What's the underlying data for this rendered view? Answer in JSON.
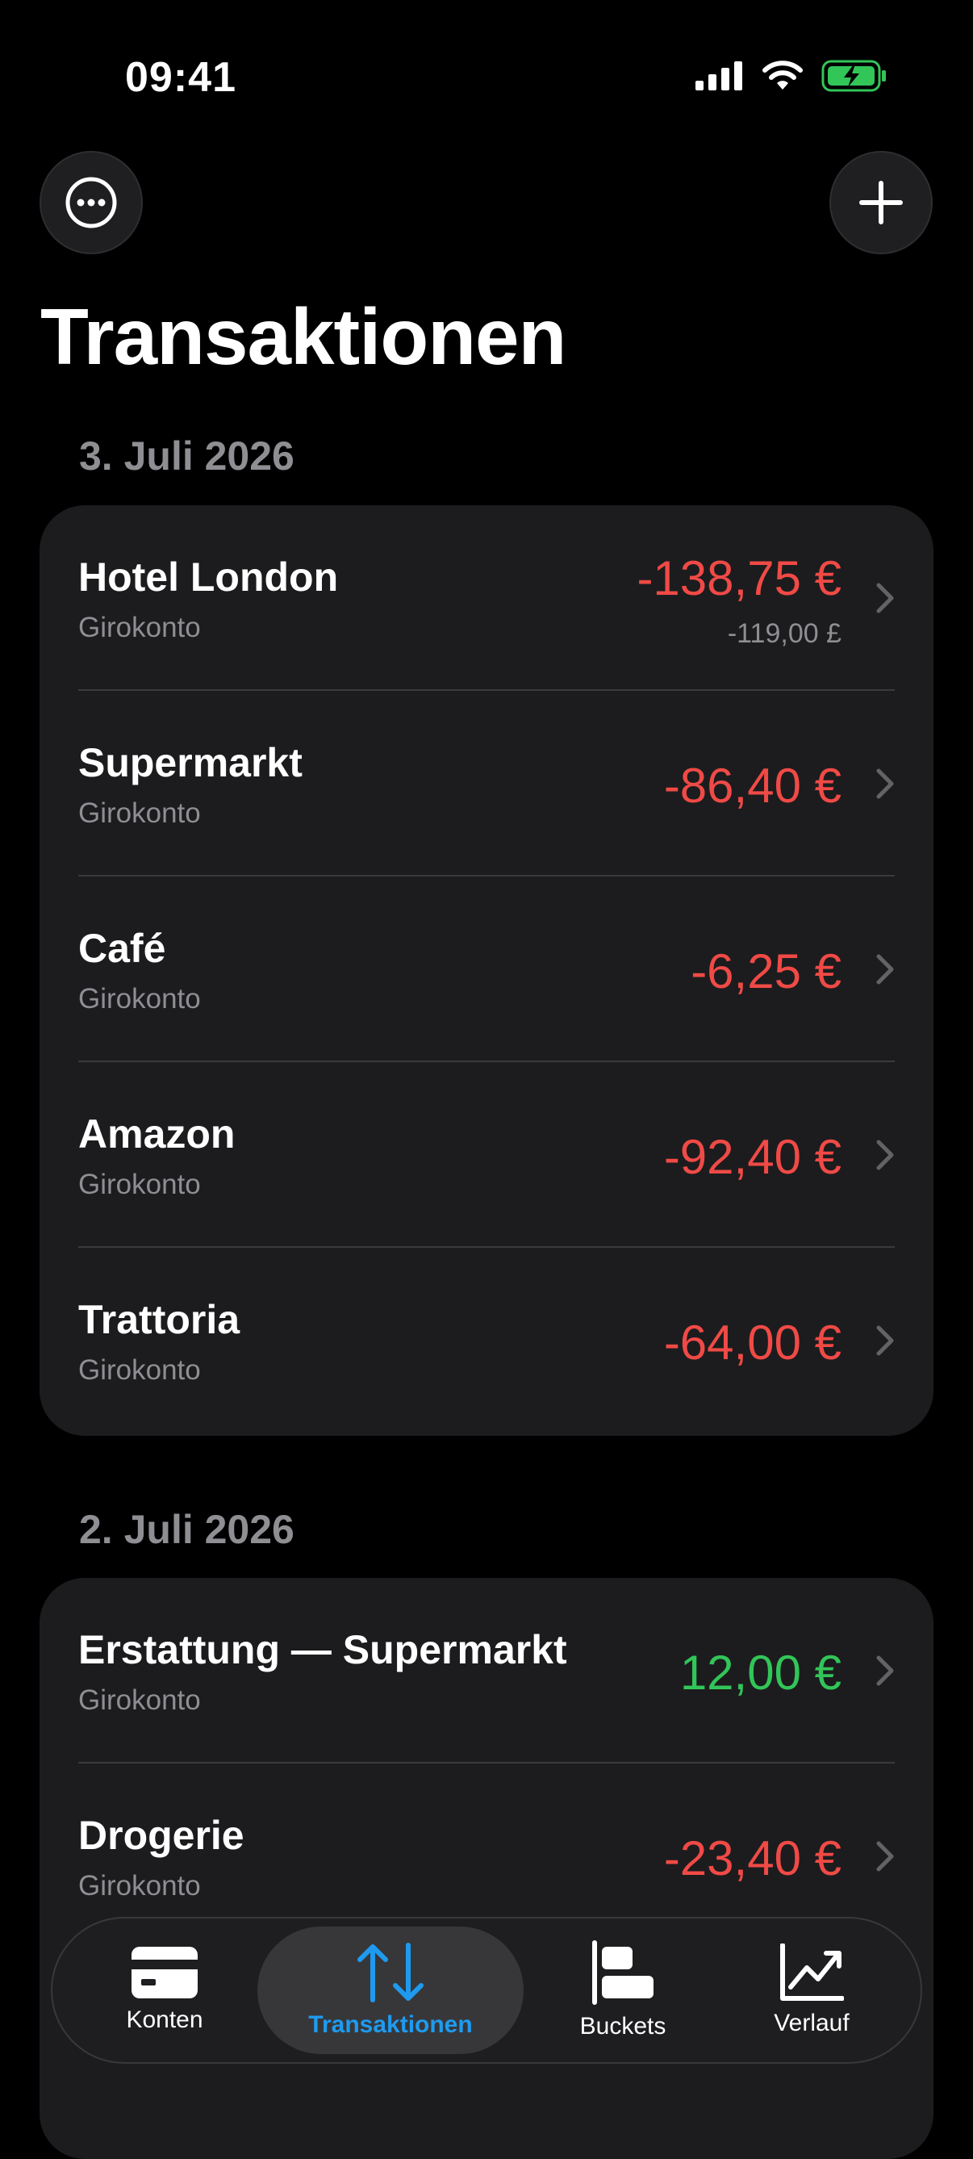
{
  "status_bar": {
    "time": "09:41",
    "icons": [
      "signal-icon",
      "wifi-icon",
      "battery-charging-icon"
    ]
  },
  "toolbar": {
    "more_icon": "ellipsis-circle-icon",
    "add_icon": "plus-icon"
  },
  "page": {
    "title": "Transaktionen"
  },
  "sections": [
    {
      "date": "3. Juli 2026",
      "transactions": [
        {
          "title": "Hotel London",
          "account": "Girokonto",
          "amount": "-138,75 €",
          "secondary": "-119,00 £",
          "type": "negative"
        },
        {
          "title": "Supermarkt",
          "account": "Girokonto",
          "amount": "-86,40 €",
          "type": "negative"
        },
        {
          "title": "Café",
          "account": "Girokonto",
          "amount": "-6,25 €",
          "type": "negative"
        },
        {
          "title": "Amazon",
          "account": "Girokonto",
          "amount": "-92,40 €",
          "type": "negative"
        },
        {
          "title": "Trattoria",
          "account": "Girokonto",
          "amount": "-64,00 €",
          "type": "negative"
        }
      ]
    },
    {
      "date": "2. Juli 2026",
      "transactions": [
        {
          "title": "Erstattung — Supermarkt",
          "account": "Girokonto",
          "amount": "12,00 €",
          "type": "positive"
        },
        {
          "title": "Drogerie",
          "account": "Girokonto",
          "amount": "-23,40 €",
          "type": "negative"
        }
      ]
    }
  ],
  "tab_bar": {
    "tabs": [
      {
        "label": "Konten",
        "icon": "card-icon",
        "active": false
      },
      {
        "label": "Transaktionen",
        "icon": "arrows-up-down-icon",
        "active": true
      },
      {
        "label": "Buckets",
        "icon": "bars-icon",
        "active": false
      },
      {
        "label": "Verlauf",
        "icon": "chart-line-icon",
        "active": false
      }
    ]
  },
  "colors": {
    "background": "#000000",
    "card": "#1c1c1e",
    "negative": "#f04a46",
    "positive": "#32c558",
    "accent": "#1e9bf0",
    "secondary_text": "#8e8e93"
  }
}
